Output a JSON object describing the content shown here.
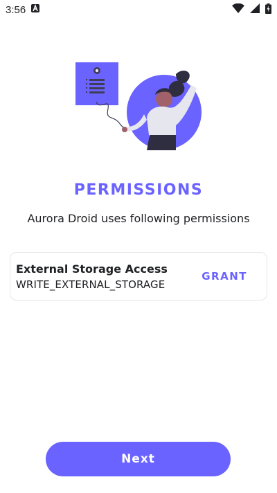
{
  "status_bar": {
    "time": "3:56",
    "icons": [
      "notification-a-icon",
      "wifi-icon",
      "signal-icon",
      "battery-charging-icon"
    ]
  },
  "colors": {
    "accent": "#6b63ff",
    "text": "#202124",
    "card_border": "#e6e6ea",
    "background": "#ffffff"
  },
  "page": {
    "title": "PERMISSIONS",
    "subtitle": "Aurora Droid uses following permissions"
  },
  "permissions": [
    {
      "name": "External Storage Access",
      "permission": "WRITE_EXTERNAL_STORAGE",
      "action_label": "GRANT"
    }
  ],
  "footer": {
    "next_label": "Next"
  }
}
